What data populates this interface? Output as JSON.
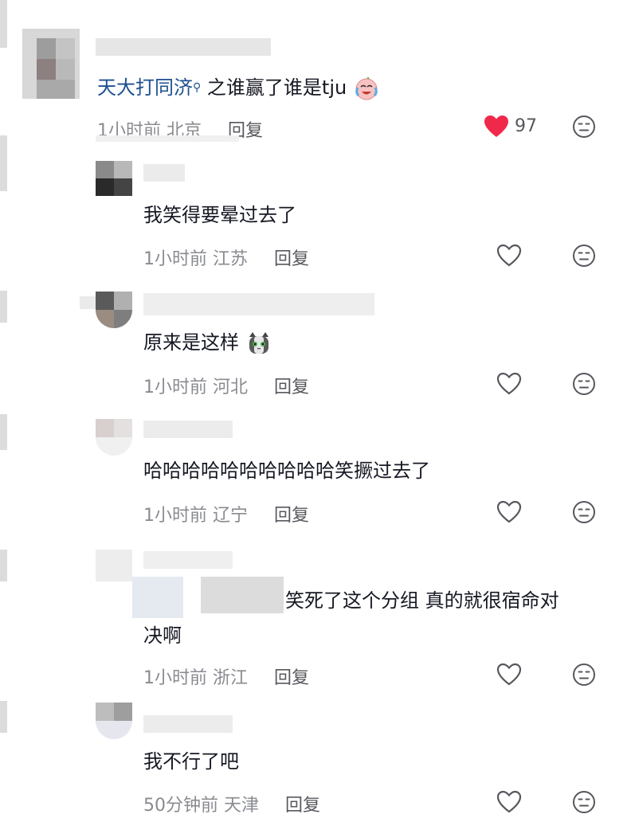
{
  "comments": [
    {
      "prefix_mention": "天大打同济",
      "text": "之谁赢了谁是tju",
      "time": "1小时前",
      "location": "北京",
      "reply_label": "回复",
      "liked": true,
      "like_count": "97"
    },
    {
      "text": "我笑得要晕过去了",
      "time": "1小时前",
      "location": "江苏",
      "reply_label": "回复",
      "liked": false
    },
    {
      "text": "原来是这样",
      "time": "1小时前",
      "location": "河北",
      "reply_label": "回复",
      "liked": false
    },
    {
      "text": "哈哈哈哈哈哈哈哈哈哈笑撅过去了",
      "time": "1小时前",
      "location": "辽宁",
      "reply_label": "回复",
      "liked": false
    },
    {
      "text_line1": "笑死了这个分组 真的就很宿命对",
      "text_line2": "决啊",
      "time": "1小时前",
      "location": "浙江",
      "reply_label": "回复",
      "liked": false
    },
    {
      "text": "我不行了吧",
      "time": "50分钟前",
      "location": "天津",
      "reply_label": "回复",
      "liked": false
    }
  ],
  "icons": {
    "heart_filled_color": "#f0294a",
    "heart_outline_color": "#8a8b91",
    "meh_icon": "meh-face-icon"
  }
}
